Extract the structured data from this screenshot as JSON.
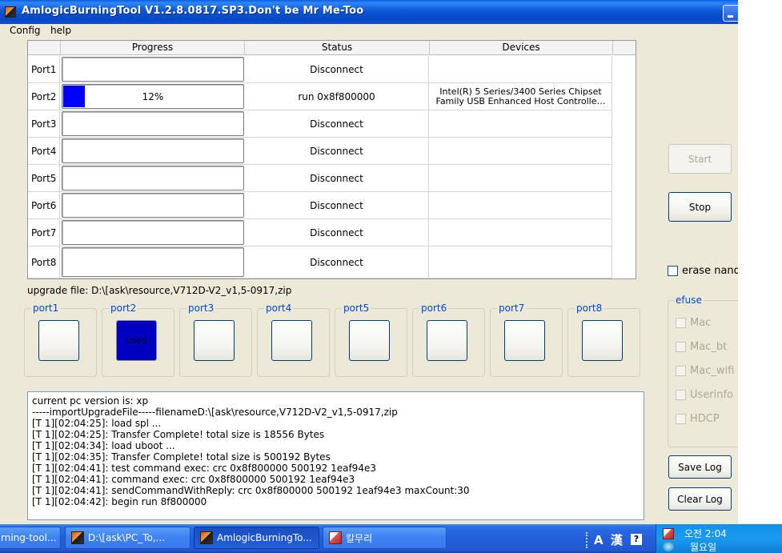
{
  "window": {
    "title": "AmlogicBurningTool  V1.2.8.0817.SP3.Don't be Mr Me-Too"
  },
  "menu": [
    "Config",
    "help"
  ],
  "grid": {
    "headers": [
      "Progress",
      "Status",
      "Devices"
    ],
    "rows": [
      {
        "port": "Port1",
        "progress_text": "",
        "progress_value": 0,
        "status": "Disconnect",
        "device": ""
      },
      {
        "port": "Port2",
        "progress_text": "12%",
        "progress_value": 12,
        "status": "run 0x8f800000",
        "device": "Intel(R) 5 Series/3400 Series Chipset Family USB Enhanced Host Controlle…"
      },
      {
        "port": "Port3",
        "progress_text": "",
        "progress_value": 0,
        "status": "Disconnect",
        "device": ""
      },
      {
        "port": "Port4",
        "progress_text": "",
        "progress_value": 0,
        "status": "Disconnect",
        "device": ""
      },
      {
        "port": "Port5",
        "progress_text": "",
        "progress_value": 0,
        "status": "Disconnect",
        "device": ""
      },
      {
        "port": "Port6",
        "progress_text": "",
        "progress_value": 0,
        "status": "Disconnect",
        "device": ""
      },
      {
        "port": "Port7",
        "progress_text": "",
        "progress_value": 0,
        "status": "Disconnect",
        "device": ""
      },
      {
        "port": "Port8",
        "progress_text": "",
        "progress_value": 0,
        "status": "Disconnect",
        "device": ""
      }
    ]
  },
  "upgrade_file": "upgrade file: D:\\[ask\\resource,V712D-V2_v1,5-0917,zip",
  "ports": [
    {
      "label": "port1",
      "state": "",
      "used": false
    },
    {
      "label": "port2",
      "state": "used",
      "used": true
    },
    {
      "label": "port3",
      "state": "",
      "used": false
    },
    {
      "label": "port4",
      "state": "",
      "used": false
    },
    {
      "label": "port5",
      "state": "",
      "used": false
    },
    {
      "label": "port6",
      "state": "",
      "used": false
    },
    {
      "label": "port7",
      "state": "",
      "used": false
    },
    {
      "label": "port8",
      "state": "",
      "used": false
    }
  ],
  "log": [
    "current pc version is: xp",
    "-----importUpgradeFile-----filenameD:\\[ask\\resource,V712D-V2_v1,5-0917,zip",
    "[T 1][02:04:25]: load spl ...",
    "[T 1][02:04:25]: Transfer Complete! total size is 18556 Bytes",
    "[T 1][02:04:34]: load uboot ...",
    "[T 1][02:04:35]: Transfer Complete! total size is 500192 Bytes",
    "[T 1][02:04:41]: test command exec: crc 0x8f800000 500192 1eaf94e3",
    "[T 1][02:04:41]: command exec: crc 0x8f800000 500192 1eaf94e3",
    "[T 1][02:04:41]: sendCommandWithReply: crc 0x8f800000 500192 1eaf94e3 maxCount:30",
    "[T 1][02:04:42]: begin run 8f800000"
  ],
  "controls": {
    "start_label": "Start",
    "stop_label": "Stop",
    "erase_nand_label": "erase nand",
    "save_log_label": "Save Log",
    "clear_log_label": "Clear Log"
  },
  "efuse": {
    "label": "efuse",
    "items": [
      "Mac",
      "Mac_bt",
      "Mac_wifi",
      "Userinfo",
      "HDCP"
    ]
  },
  "taskbar": {
    "items": [
      {
        "label": "rning-tool...",
        "icon": "none"
      },
      {
        "label": "D:\\[ask\\PC_To,...",
        "icon": "amlogic-app-icon"
      },
      {
        "label": "AmlogicBurningTo...",
        "icon": "amlogic-app-icon",
        "active": true
      },
      {
        "label": "칼무리",
        "icon": "paint-icon"
      }
    ],
    "lang": "A 漢",
    "lang_help": "?",
    "clock_time": "오전 2:04",
    "clock_day": "월요일"
  },
  "colors": {
    "progress_fill": "#0000ff",
    "used_port": "#0000c0",
    "group_label": "#0046d5",
    "window_bg": "#ece9d8"
  }
}
